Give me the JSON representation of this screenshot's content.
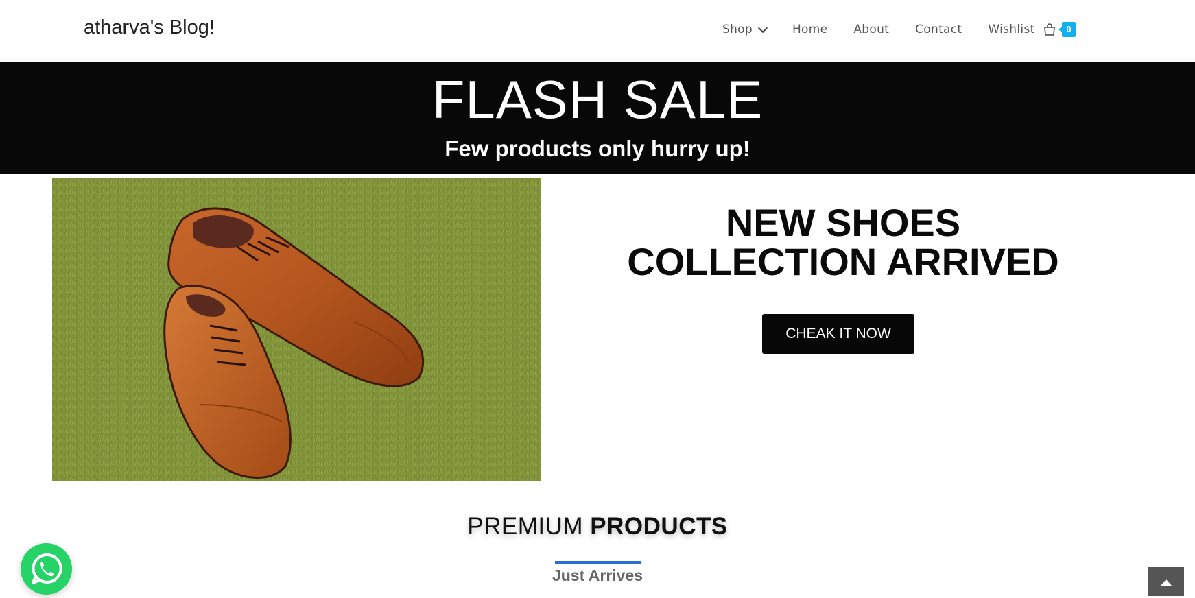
{
  "header": {
    "site_title": "atharva's Blog!",
    "nav": [
      {
        "label": "Shop",
        "has_dropdown": true
      },
      {
        "label": "Home"
      },
      {
        "label": "About"
      },
      {
        "label": "Contact"
      },
      {
        "label": "Wishlist"
      }
    ],
    "cart": {
      "icon": "shopping-bag-icon",
      "count": "0",
      "badge_color": "#13aff0"
    }
  },
  "banner": {
    "title": "FLASH SALE",
    "subtitle": "Few products only hurry up!",
    "background": "#080808"
  },
  "hero": {
    "image": "brown-leather-oxford-shoes-on-grass",
    "heading_line1": "NEW SHOES",
    "heading_line2": "COLLECTION ARRIVED",
    "cta_label": "CHEAK IT NOW"
  },
  "products_section": {
    "title_light": "PREMIUM",
    "title_bold": "PRODUCTS",
    "active_tab": "Just Arrives",
    "accent": "#2a6fd6"
  },
  "floating": {
    "whatsapp_icon": "whatsapp-icon",
    "whatsapp_color": "#25d366",
    "scroll_top_icon": "arrow-up-icon"
  }
}
